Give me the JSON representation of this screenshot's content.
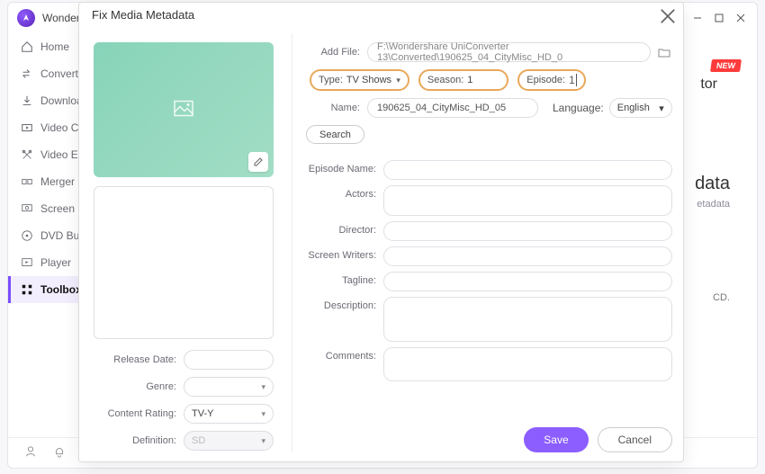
{
  "app": {
    "title": "Wonder"
  },
  "sidebar": {
    "items": [
      {
        "label": "Home"
      },
      {
        "label": "Convert"
      },
      {
        "label": "Downloa"
      },
      {
        "label": "Video Co"
      },
      {
        "label": "Video Ec"
      },
      {
        "label": "Merger"
      },
      {
        "label": "Screen R"
      },
      {
        "label": "DVD Bu"
      },
      {
        "label": "Player"
      },
      {
        "label": "Toolbox"
      }
    ]
  },
  "peek": {
    "new_badge": "NEW",
    "tor_fragment": "tor",
    "heading": "data",
    "sub": "etadata",
    "body": "CD."
  },
  "modal": {
    "title": "Fix Media Metadata",
    "left": {
      "release_date": "Release Date:",
      "genre": "Genre:",
      "content_rating": "Content Rating:",
      "content_rating_value": "TV-Y",
      "definition": "Definition:",
      "definition_value": "SD"
    },
    "form": {
      "add_file_label": "Add File:",
      "add_file_value": "F:\\Wondershare UniConverter 13\\Converted\\190625_04_CityMisc_HD_0",
      "type_label": "Type:",
      "type_value": "TV Shows",
      "season_label": "Season:",
      "season_value": "1",
      "episode_label": "Episode:",
      "episode_value": "1",
      "name_label": "Name:",
      "name_value": "190625_04_CityMisc_HD_05",
      "language_label": "Language:",
      "language_value": "English",
      "search_label": "Search",
      "episode_name_label": "Episode Name:",
      "actors_label": "Actors:",
      "director_label": "Director:",
      "screen_writers_label": "Screen Writers:",
      "tagline_label": "Tagline:",
      "description_label": "Description:",
      "comments_label": "Comments:"
    },
    "actions": {
      "save": "Save",
      "cancel": "Cancel"
    }
  }
}
